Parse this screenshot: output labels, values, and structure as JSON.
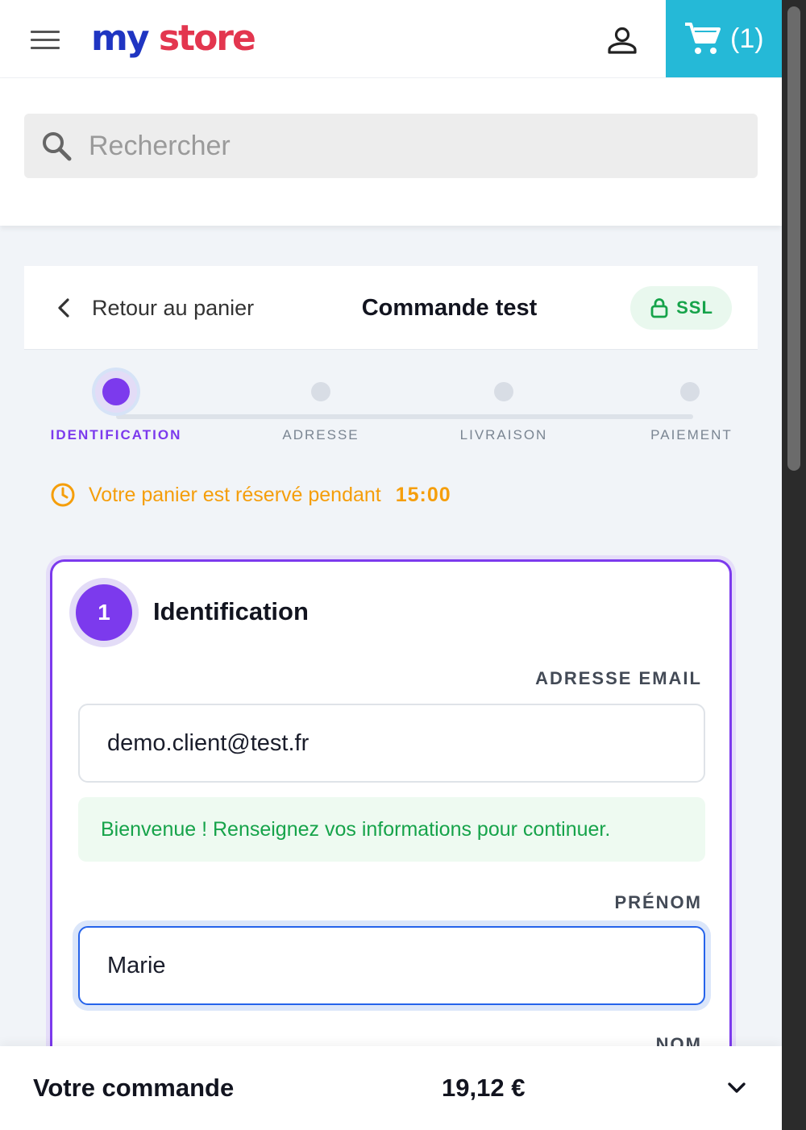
{
  "header": {
    "logo_part1": "my",
    "logo_part2": "store",
    "cart_count": "(1)",
    "colors": {
      "cart_bg": "#25b9d7",
      "logo_blue": "#1f35c2",
      "logo_red": "#e3364f"
    },
    "icons": [
      "menu-icon",
      "account-icon",
      "cart-icon"
    ]
  },
  "search": {
    "placeholder": "Rechercher",
    "icon": "search-icon"
  },
  "checkout": {
    "back_label": "Retour au panier",
    "title": "Commande test",
    "ssl_label": "SSL",
    "steps": [
      {
        "label": "IDENTIFICATION",
        "active": true
      },
      {
        "label": "ADRESSE",
        "active": false
      },
      {
        "label": "LIVRAISON",
        "active": false
      },
      {
        "label": "PAIEMENT",
        "active": false
      }
    ],
    "timer_text": "Votre panier est réservé pendant",
    "timer_value": "15:00",
    "colors": {
      "accent": "#7c3aed",
      "success": "#16a34a",
      "warning": "#f59e0b",
      "focus": "#2563eb"
    }
  },
  "identification": {
    "step_number": "1",
    "title": "Identification",
    "email_label": "ADRESSE EMAIL",
    "email_value": "demo.client@test.fr",
    "welcome_message": "Bienvenue ! Renseignez vos informations pour continuer.",
    "firstname_label": "PRÉNOM",
    "firstname_value": "Marie",
    "lastname_label": "NOM"
  },
  "order_bar": {
    "label": "Votre commande",
    "total": "19,12 €"
  }
}
